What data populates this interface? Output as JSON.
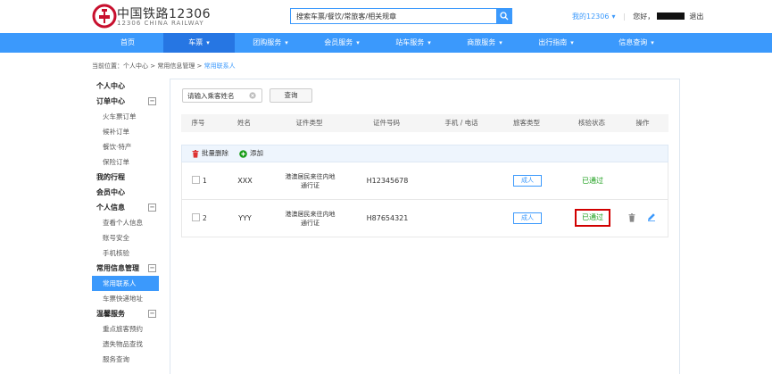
{
  "header": {
    "logo_cn": "中国铁路12306",
    "logo_en": "12306 CHINA RAILWAY",
    "search_placeholder": "搜索车票/餐饮/常旅客/相关规章",
    "my_12306": "我的12306",
    "hello": "您好，",
    "logout": "退出"
  },
  "nav": [
    {
      "label": "首页",
      "caret": ""
    },
    {
      "label": "车票",
      "caret": "▾"
    },
    {
      "label": "团购服务",
      "caret": "▾"
    },
    {
      "label": "会员服务",
      "caret": "▾"
    },
    {
      "label": "站车服务",
      "caret": "▾"
    },
    {
      "label": "商旅服务",
      "caret": "▾"
    },
    {
      "label": "出行指南",
      "caret": "▾"
    },
    {
      "label": "信息查询",
      "caret": "▾"
    }
  ],
  "breadcrumb": {
    "prefix": "当前位置：个人中心 > 常用信息管理 > ",
    "current": "常用联系人"
  },
  "sidebar": [
    {
      "label": "个人中心",
      "kind": "head",
      "toggle": ""
    },
    {
      "label": "订单中心",
      "kind": "head",
      "toggle": "−"
    },
    {
      "label": "火车票订单",
      "kind": "item"
    },
    {
      "label": "候补订单",
      "kind": "item"
    },
    {
      "label": "餐饮·特产",
      "kind": "item"
    },
    {
      "label": "保险订单",
      "kind": "item"
    },
    {
      "label": "我的行程",
      "kind": "head",
      "toggle": ""
    },
    {
      "label": "会员中心",
      "kind": "head",
      "toggle": ""
    },
    {
      "label": "个人信息",
      "kind": "head",
      "toggle": "−"
    },
    {
      "label": "查看个人信息",
      "kind": "item"
    },
    {
      "label": "账号安全",
      "kind": "item"
    },
    {
      "label": "手机核验",
      "kind": "item"
    },
    {
      "label": "常用信息管理",
      "kind": "head",
      "toggle": "−"
    },
    {
      "label": "常用联系人",
      "kind": "item",
      "active": true
    },
    {
      "label": "车票快递地址",
      "kind": "item"
    },
    {
      "label": "温馨服务",
      "kind": "head",
      "toggle": "−"
    },
    {
      "label": "重点旅客预约",
      "kind": "item"
    },
    {
      "label": "遗失物品查找",
      "kind": "item"
    },
    {
      "label": "服务查询",
      "kind": "item"
    }
  ],
  "filter": {
    "name_placeholder": "请输入乘客姓名",
    "query_label": "查询"
  },
  "table": {
    "headers": [
      "序号",
      "姓名",
      "证件类型",
      "证件号码",
      "手机 / 电话",
      "旅客类型",
      "核验状态",
      "操作"
    ],
    "batch_delete": "批量删除",
    "add": "添加",
    "rows": [
      {
        "index": "1",
        "name": "XXX",
        "id_type_line1": "港澳居民来往内地",
        "id_type_line2": "通行证",
        "id_number": "H12345678",
        "phone": "",
        "passenger_type": "成人",
        "status": "已通过"
      },
      {
        "index": "2",
        "name": "YYY",
        "id_type_line1": "港澳居民来往内地",
        "id_type_line2": "通行证",
        "id_number": "H87654321",
        "phone": "",
        "passenger_type": "成人",
        "status": "已通过"
      }
    ]
  },
  "colors": {
    "primary": "#3b99fc",
    "nav_active": "#2676e3",
    "logo_red": "#c8102e",
    "status_green": "#1a9e1a",
    "highlight_red": "#d10000"
  }
}
